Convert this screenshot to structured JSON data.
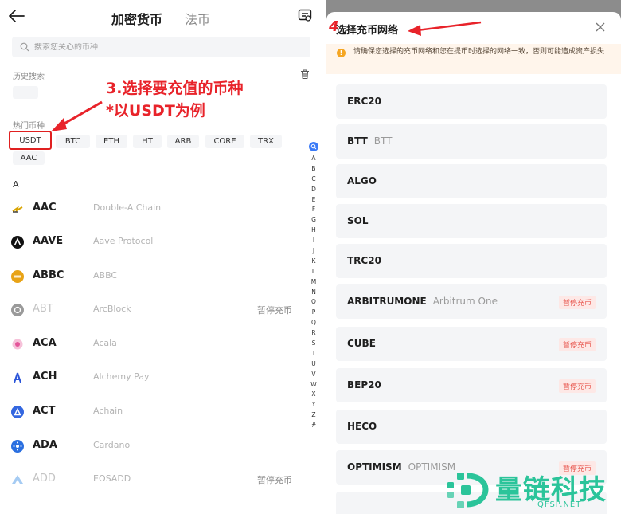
{
  "left": {
    "tabs": [
      {
        "label": "加密货币",
        "active": true
      },
      {
        "label": "法币",
        "active": false
      }
    ],
    "search": {
      "placeholder": "搜索您关心的币种"
    },
    "history_label": "历史搜索",
    "hot_label": "热门币种",
    "hot_coins": [
      "USDT",
      "BTC",
      "ETH",
      "HT",
      "ARB",
      "CORE",
      "TRX",
      "AAC"
    ],
    "annotation": {
      "line1": "3.选择要充值的币种",
      "line2": "*以USDT为例"
    },
    "section_letter": "A",
    "coins": [
      {
        "symbol": "AAC",
        "name": "Double-A Chain",
        "status": ""
      },
      {
        "symbol": "AAVE",
        "name": "Aave Protocol",
        "status": ""
      },
      {
        "symbol": "ABBC",
        "name": "ABBC",
        "status": ""
      },
      {
        "symbol": "ABT",
        "name": "ArcBlock",
        "status": "暂停充币"
      },
      {
        "symbol": "ACA",
        "name": "Acala",
        "status": ""
      },
      {
        "symbol": "ACH",
        "name": "Alchemy Pay",
        "status": ""
      },
      {
        "symbol": "ACT",
        "name": "Achain",
        "status": ""
      },
      {
        "symbol": "ADA",
        "name": "Cardano",
        "status": ""
      },
      {
        "symbol": "ADD",
        "name": "EOSADD",
        "status": "暂停充币"
      }
    ],
    "alphabet": [
      "A",
      "B",
      "C",
      "D",
      "E",
      "F",
      "G",
      "H",
      "I",
      "J",
      "K",
      "L",
      "M",
      "N",
      "O",
      "P",
      "Q",
      "R",
      "S",
      "T",
      "U",
      "V",
      "W",
      "X",
      "Y",
      "Z",
      "#"
    ]
  },
  "right": {
    "step": "4",
    "title": "选择充币网络",
    "warning": "请确保您选择的充币网络和您在提币时选择的网络一致，否则可能造成资产损失",
    "networks": [
      {
        "name": "ERC20",
        "sub": "",
        "badge": ""
      },
      {
        "name": "BTT",
        "sub": "BTT",
        "badge": ""
      },
      {
        "name": "ALGO",
        "sub": "",
        "badge": ""
      },
      {
        "name": "SOL",
        "sub": "",
        "badge": ""
      },
      {
        "name": "TRC20",
        "sub": "",
        "badge": ""
      },
      {
        "name": "ARBITRUMONE",
        "sub": "Arbitrum One",
        "badge": "暂停充币"
      },
      {
        "name": "CUBE",
        "sub": "",
        "badge": "暂停充币"
      },
      {
        "name": "BEP20",
        "sub": "",
        "badge": "暂停充币"
      },
      {
        "name": "HECO",
        "sub": "",
        "badge": ""
      },
      {
        "name": "OPTIMISM",
        "sub": "OPTIMISM",
        "badge": "暂停充币"
      }
    ]
  },
  "watermark": {
    "text": "量链科技",
    "url": "QFSP.NET"
  },
  "colors": {
    "accent_red": "#e8232a",
    "brand_green": "#2bc49a",
    "index_blue": "#3a7af7"
  }
}
